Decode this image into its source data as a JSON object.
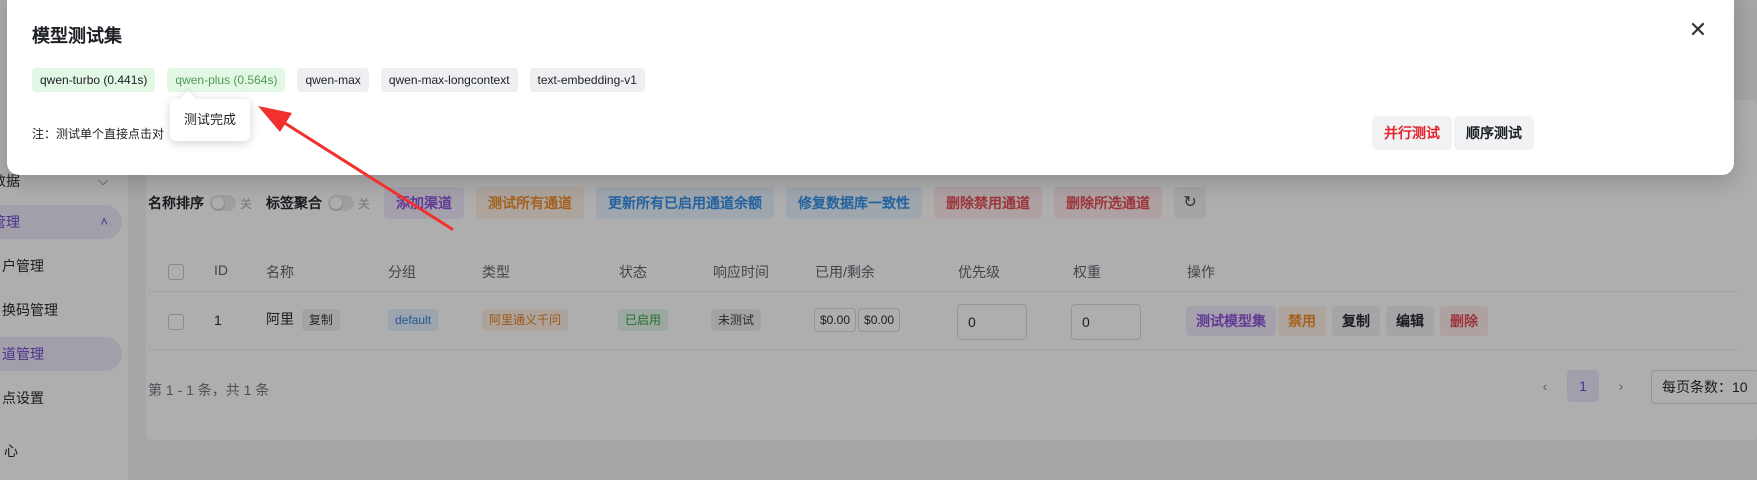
{
  "sidebar": {
    "items": [
      {
        "label": "数据"
      },
      {
        "label": "管理"
      },
      {
        "label": "户管理"
      },
      {
        "label": "换码管理"
      },
      {
        "label": "道管理"
      },
      {
        "label": "点设置"
      },
      {
        "label": "心"
      }
    ]
  },
  "toolbar": {
    "sort_label": "名称排序",
    "sort_state": "关",
    "group_label": "标签聚合",
    "group_state": "关",
    "buttons": [
      "添加渠道",
      "测试所有通道",
      "更新所有已启用通道余额",
      "修复数据库一致性",
      "删除禁用通道",
      "删除所选通道"
    ],
    "refresh_icon": "refresh-icon"
  },
  "table": {
    "headers": [
      "ID",
      "名称",
      "分组",
      "类型",
      "状态",
      "响应时间",
      "已用/剩余",
      "优先级",
      "权重",
      "操作"
    ],
    "rows": [
      {
        "id": "1",
        "name": "阿里",
        "copy_tag": "复制",
        "group": "default",
        "type": "阿里通义千问",
        "status": "已启用",
        "response": "未测试",
        "used": "$0.00",
        "remaining": "$0.00",
        "priority": "0",
        "weight": "0",
        "actions": [
          "测试模型集",
          "禁用",
          "复制",
          "编辑",
          "删除"
        ]
      }
    ]
  },
  "pagination": {
    "info": "第 1 - 1 条，共 1 条",
    "current": "1",
    "prev_icon": "chevron-left-icon",
    "next_icon": "chevron-right-icon",
    "page_size": "每页条数：10"
  },
  "modal": {
    "title": "模型测试集",
    "close_icon": "close-icon",
    "models": [
      {
        "label": "qwen-turbo (0.441s)",
        "state": "ok"
      },
      {
        "label": "qwen-plus (0.564s)",
        "state": "ok"
      },
      {
        "label": "qwen-max",
        "state": "idle"
      },
      {
        "label": "qwen-max-longcontext",
        "state": "idle"
      },
      {
        "label": "text-embedding-v1",
        "state": "idle"
      }
    ],
    "note": "注：测试单个直接点击对",
    "tooltip": "测试完成",
    "parallel_button": "并行测试",
    "sequential_button": "顺序测试"
  },
  "colors": {
    "accent": "#6b3fc9",
    "danger": "#e5242c",
    "success_bg": "#e3f7e5",
    "annotation_arrow": "#f0312e"
  }
}
